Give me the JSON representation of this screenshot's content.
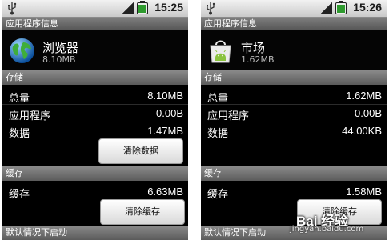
{
  "phones": [
    {
      "status_time": "15:25",
      "title": "应用程序信息",
      "app_name": "浏览器",
      "app_size": "8.10MB",
      "storage_header": "存储",
      "rows": [
        {
          "label": "总量",
          "value": "8.10MB"
        },
        {
          "label": "应用程序",
          "value": "0.00B"
        },
        {
          "label": "数据",
          "value": "1.47MB"
        }
      ],
      "clear_data_label": "清除数据",
      "cache_header": "缓存",
      "cache_label": "缓存",
      "cache_value": "6.63MB",
      "clear_cache_label": "清除缓存",
      "defaults_header": "默认情况下启动"
    },
    {
      "status_time": "15:26",
      "title": "应用程序信息",
      "app_name": "市场",
      "app_size": "1.62MB",
      "storage_header": "存储",
      "rows": [
        {
          "label": "总量",
          "value": "1.62MB"
        },
        {
          "label": "应用程序",
          "value": "0.00B"
        },
        {
          "label": "数据",
          "value": "44.00KB"
        }
      ],
      "cache_header": "缓存",
      "cache_label": "缓存",
      "cache_value": "1.58MB",
      "clear_cache_label": "清除缓存",
      "defaults_header": "默认情况下启动"
    }
  ],
  "watermark": {
    "brand": "Bai 经验",
    "url": "jingyan.baidu.com"
  },
  "colors": {
    "accent_green": "#2e9a2e",
    "section_grey": "#6e6e6e",
    "background": "#000000"
  },
  "icons": {
    "browser": "globe-icon",
    "market": "android-market-bag-icon"
  }
}
